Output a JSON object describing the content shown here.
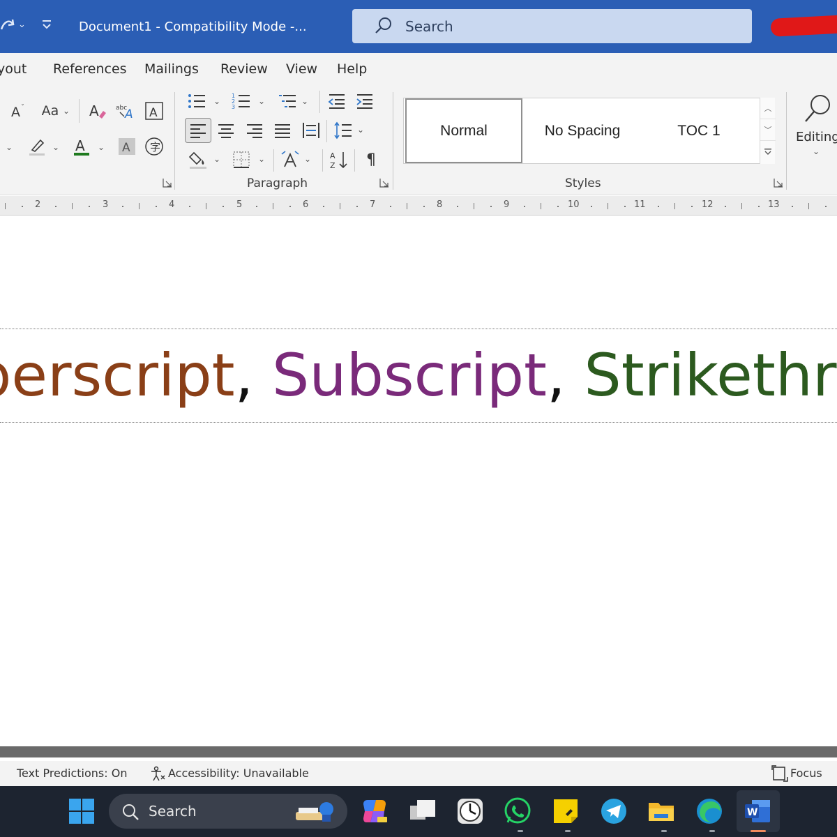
{
  "titlebar": {
    "document_title": "Document1  -  Compatibility Mode  -...",
    "search_placeholder": "Search",
    "bg_color": "#2b5eb5"
  },
  "tabs": [
    "yout",
    "References",
    "Mailings",
    "Review",
    "View",
    "Help"
  ],
  "ribbon": {
    "font_case_label": "Aa",
    "paragraph_group_label": "Paragraph",
    "styles_group_label": "Styles",
    "styles": [
      "Normal",
      "No Spacing",
      "TOC 1"
    ],
    "editing_label": "Editing"
  },
  "ruler": {
    "numbers": [
      "2",
      "3",
      "4",
      "5",
      "6",
      "7",
      "8",
      "9",
      "10",
      "11",
      "12",
      "13"
    ]
  },
  "document": {
    "word1": "perscript",
    "comma1": ",",
    "word2": " Subscript",
    "comma2": ",",
    "word3": " Strikethro",
    "colors": {
      "word1": "#8a3f17",
      "word2": "#7a2a7a",
      "word3": "#2c5a1f"
    }
  },
  "status": {
    "text_predictions": "Text Predictions: On",
    "accessibility": "Accessibility: Unavailable",
    "focus": "Focus"
  },
  "taskbar": {
    "search_label": "Search",
    "apps": [
      "start-icon",
      "copilot-icon",
      "file-explorer-small-icon",
      "clock-icon",
      "whatsapp-icon",
      "sticky-notes-icon",
      "telegram-icon",
      "folder-icon",
      "edge-icon",
      "word-icon"
    ]
  }
}
